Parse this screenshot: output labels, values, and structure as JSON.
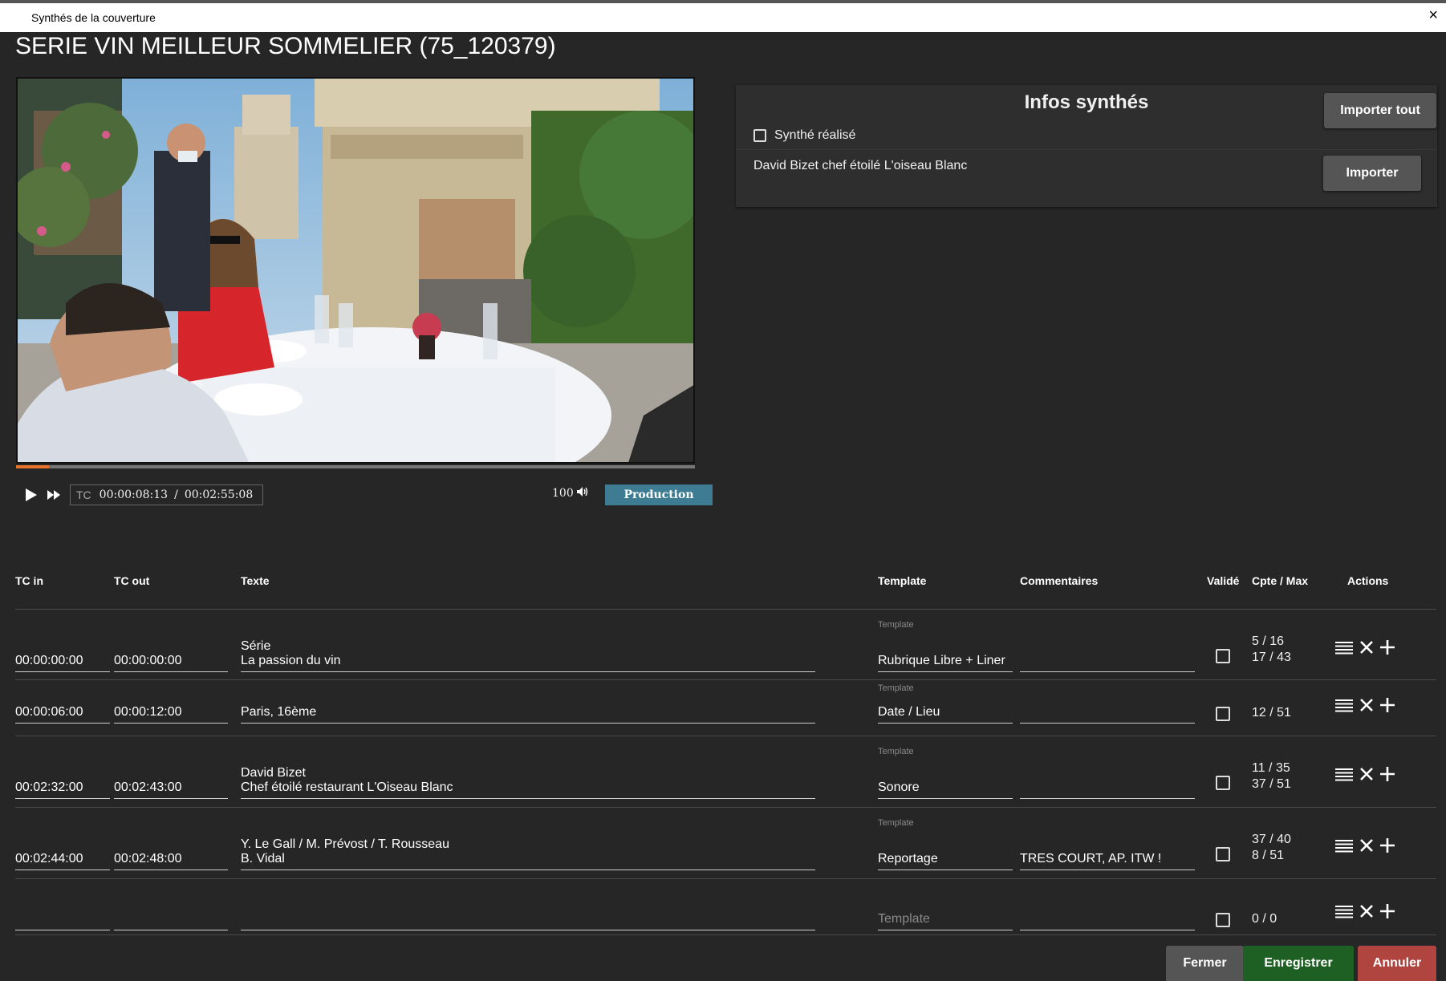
{
  "window": {
    "title": "Synthés de la couverture",
    "close_glyph": "×"
  },
  "page_title": "SERIE VIN MEILLEUR SOMMELIER (75_120379)",
  "player": {
    "progress_fraction": 0.048,
    "tc_label": "TC",
    "current_tc": "00:00:08:13",
    "separator": "/",
    "total_tc": "00:02:55:08",
    "volume": "100",
    "production_label": "Production",
    "icons": [
      "play-icon",
      "fast-forward-icon",
      "volume-icon"
    ]
  },
  "infos": {
    "title": "Infos synthés",
    "import_all_label": "Importer tout",
    "synthe_realise_label": "Synthé réalisé",
    "text": "David Bizet chef étoilé L'oiseau Blanc",
    "import_label": "Importer"
  },
  "table": {
    "headers": {
      "tc_in": "TC in",
      "tc_out": "TC out",
      "texte": "Texte",
      "template": "Template",
      "commentaires": "Commentaires",
      "valide": "Validé",
      "cpte_max": "Cpte / Max",
      "actions": "Actions"
    },
    "template_field_label": "Template",
    "template_placeholder": "Template",
    "rows": [
      {
        "tc_in": "00:00:00:00",
        "tc_out": "00:00:00:00",
        "text_line1": "Série",
        "text_line2": "La passion du vin",
        "template": "Rubrique Libre + Liner",
        "commentaire": "",
        "cpte_line1": "5 / 16",
        "cpte_line2": "17 / 43"
      },
      {
        "tc_in": "00:00:06:00",
        "tc_out": "00:00:12:00",
        "text_line1": "Paris, 16ème",
        "text_line2": "",
        "template": "Date / Lieu",
        "commentaire": "",
        "cpte_line1": "12 / 51",
        "cpte_line2": ""
      },
      {
        "tc_in": "00:02:32:00",
        "tc_out": "00:02:43:00",
        "text_line1": "David Bizet",
        "text_line2": "Chef étoilé restaurant L'Oiseau Blanc",
        "template": "Sonore",
        "commentaire": "",
        "cpte_line1": "11 / 35",
        "cpte_line2": "37 / 51"
      },
      {
        "tc_in": "00:02:44:00",
        "tc_out": "00:02:48:00",
        "text_line1": "Y. Le Gall / M. Prévost / T. Rousseau",
        "text_line2": "B. Vidal",
        "template": "Reportage",
        "commentaire": "TRES COURT, AP. ITW !",
        "cpte_line1": "37 / 40",
        "cpte_line2": "8 / 51"
      },
      {
        "tc_in": "",
        "tc_out": "",
        "text_line1": "",
        "text_line2": "",
        "template": "",
        "commentaire": "",
        "cpte_line1": "0 / 0",
        "cpte_line2": ""
      }
    ]
  },
  "footer": {
    "fermer": "Fermer",
    "enregistrer": "Enregistrer",
    "annuler": "Annuler"
  },
  "colors": {
    "background": "#262626",
    "production": "#3d7c92",
    "progress": "#e8742c",
    "fermer": "#555555",
    "enregistrer": "#1e5f23",
    "annuler": "#b0453f"
  }
}
